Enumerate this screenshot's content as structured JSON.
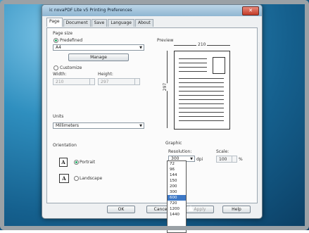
{
  "window": {
    "title": "ic novaPDF Lite v5 Printing Preferences"
  },
  "tabs": [
    "Page",
    "Document",
    "Save",
    "Language",
    "About"
  ],
  "page_size": {
    "heading": "Page size",
    "predefined_label": "Predefined",
    "predefined_value": "A4",
    "manage_label": "Manage",
    "customize_label": "Customize",
    "width_label": "Width:",
    "width_value": "210",
    "height_label": "Height:",
    "height_value": "297"
  },
  "units": {
    "heading": "Units",
    "value": "Millimeters"
  },
  "orientation": {
    "heading": "Orientation",
    "portrait_label": "Portrait",
    "landscape_label": "Landscape"
  },
  "preview": {
    "heading": "Preview",
    "width_mm": "210",
    "height_mm": "297"
  },
  "graphic": {
    "heading": "Graphic",
    "resolution_label": "Resolution:",
    "resolution_value": "300",
    "dpi_label": "dpi",
    "scale_label": "Scale:",
    "scale_value": "100",
    "percent_label": "%"
  },
  "resolution_options": [
    "72",
    "96",
    "144",
    "150",
    "200",
    "300",
    "600",
    "720",
    "1200",
    "1440"
  ],
  "resolution_selected_index": 6,
  "footer": {
    "ok_label": "OK",
    "cancel_label": "Cance",
    "apply_label": "Apply",
    "help_label": "Help"
  },
  "colors": {
    "desktop_bg": "#1b6f9e",
    "selection": "#3d78c6"
  }
}
